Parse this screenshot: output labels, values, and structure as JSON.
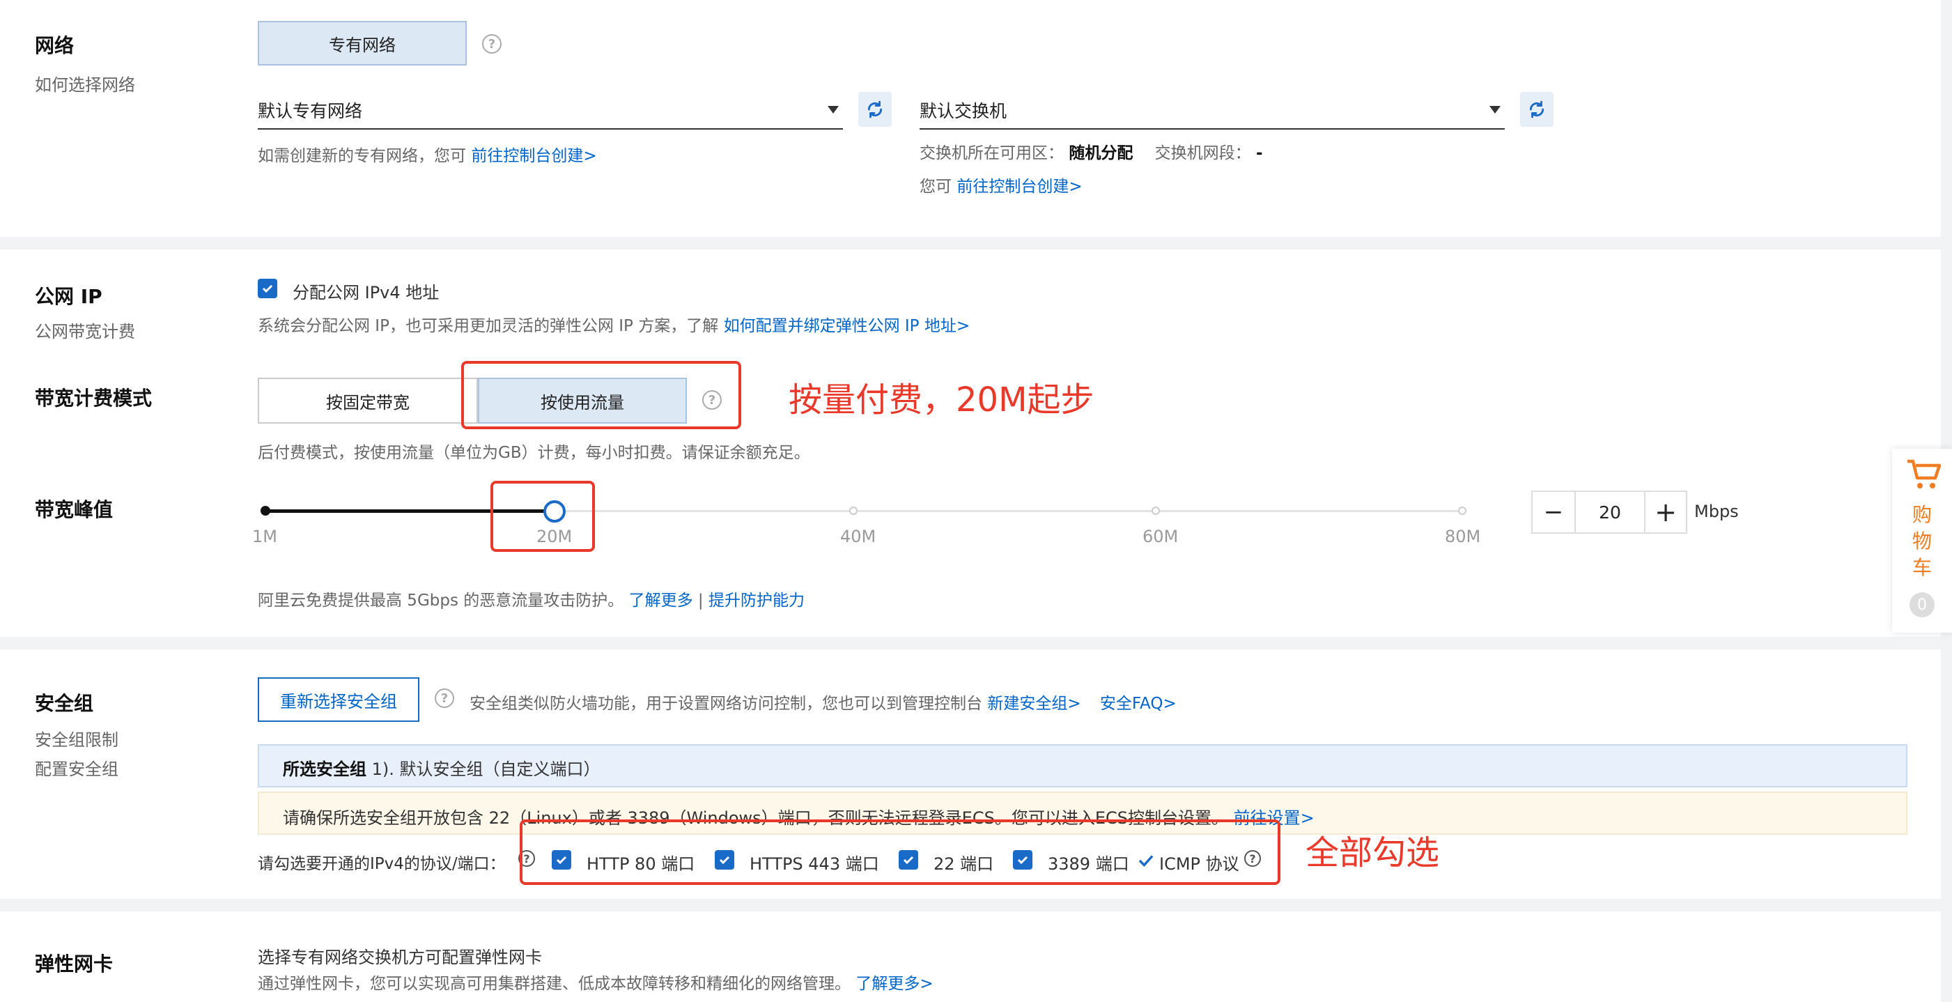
{
  "network": {
    "title": "网络",
    "subtitle": "如何选择网络",
    "type_button": "专有网络",
    "vpc_select": "默认专有网络",
    "vpc_hint_prefix": "如需创建新的专有网络，您可",
    "vpc_hint_link": "前往控制台创建>",
    "vswitch_select": "默认交换机",
    "zone_label": "交换机所在可用区：",
    "zone_value": "随机分配",
    "segment_label": "交换机网段：",
    "segment_value": "-",
    "vswitch_hint_prefix": "您可",
    "vswitch_hint_link": "前往控制台创建>"
  },
  "public_ip": {
    "title": "公网 IP",
    "subtitle": "公网带宽计费",
    "checkbox_label": "分配公网 IPv4 地址",
    "hint_prefix": "系统会分配公网 IP，也可采用更加灵活的弹性公网 IP 方案，了解",
    "hint_link": "如何配置并绑定弹性公网 IP 地址>"
  },
  "billing": {
    "title": "带宽计费模式",
    "fixed_button": "按固定带宽",
    "traffic_button": "按使用流量",
    "hint": "后付费模式，按使用流量（单位为GB）计费，每小时扣费。请保证余额充足。"
  },
  "bandwidth": {
    "title": "带宽峰值",
    "ticks": [
      "1M",
      "20M",
      "40M",
      "60M",
      "80M"
    ],
    "value": "20",
    "unit": "Mbps",
    "minus": "−",
    "plus": "+",
    "protect_prefix": "阿里云免费提供最高 5Gbps 的恶意流量攻击防护。",
    "learn_more": "了解更多",
    "separator": "|",
    "improve_link": "提升防护能力"
  },
  "security": {
    "title": "安全组",
    "subtitle1": "安全组限制",
    "subtitle2": "配置安全组",
    "reselect_button": "重新选择安全组",
    "hint": "安全组类似防火墙功能，用于设置网络访问控制，您也可以到管理控制台",
    "new_link": "新建安全组>",
    "faq_link": "安全FAQ>",
    "selected_label": "所选安全组",
    "selected_value": "1). 默认安全组（自定义端口）",
    "warning": "请确保所选安全组开放包含 22（Linux）或者 3389（Windows）端口，否则无法远程登录ECS。您可以进入ECS控制台设置。",
    "warning_link": "前往设置>",
    "ports_label": "请勾选要开通的IPv4的协议/端口：",
    "ports": [
      "HTTP 80 端口",
      "HTTPS 443 端口",
      "22 端口",
      "3389 端口"
    ],
    "icmp": "ICMP 协议"
  },
  "eni": {
    "title": "弹性网卡",
    "line1": "选择专有网络交换机方可配置弹性网卡",
    "line2_prefix": "通过弹性网卡，您可以实现高可用集群搭建、低成本故障转移和精细化的网络管理。",
    "line2_link": "了解更多>"
  },
  "cart": {
    "label": "购物车",
    "count": "0"
  },
  "annotations": {
    "billing_note": "按量付费，20M起步",
    "ports_note": "全部勾选"
  },
  "colors": {
    "accent": "#0064c8",
    "annotation": "#e8392b",
    "cart": "#f07c24"
  }
}
